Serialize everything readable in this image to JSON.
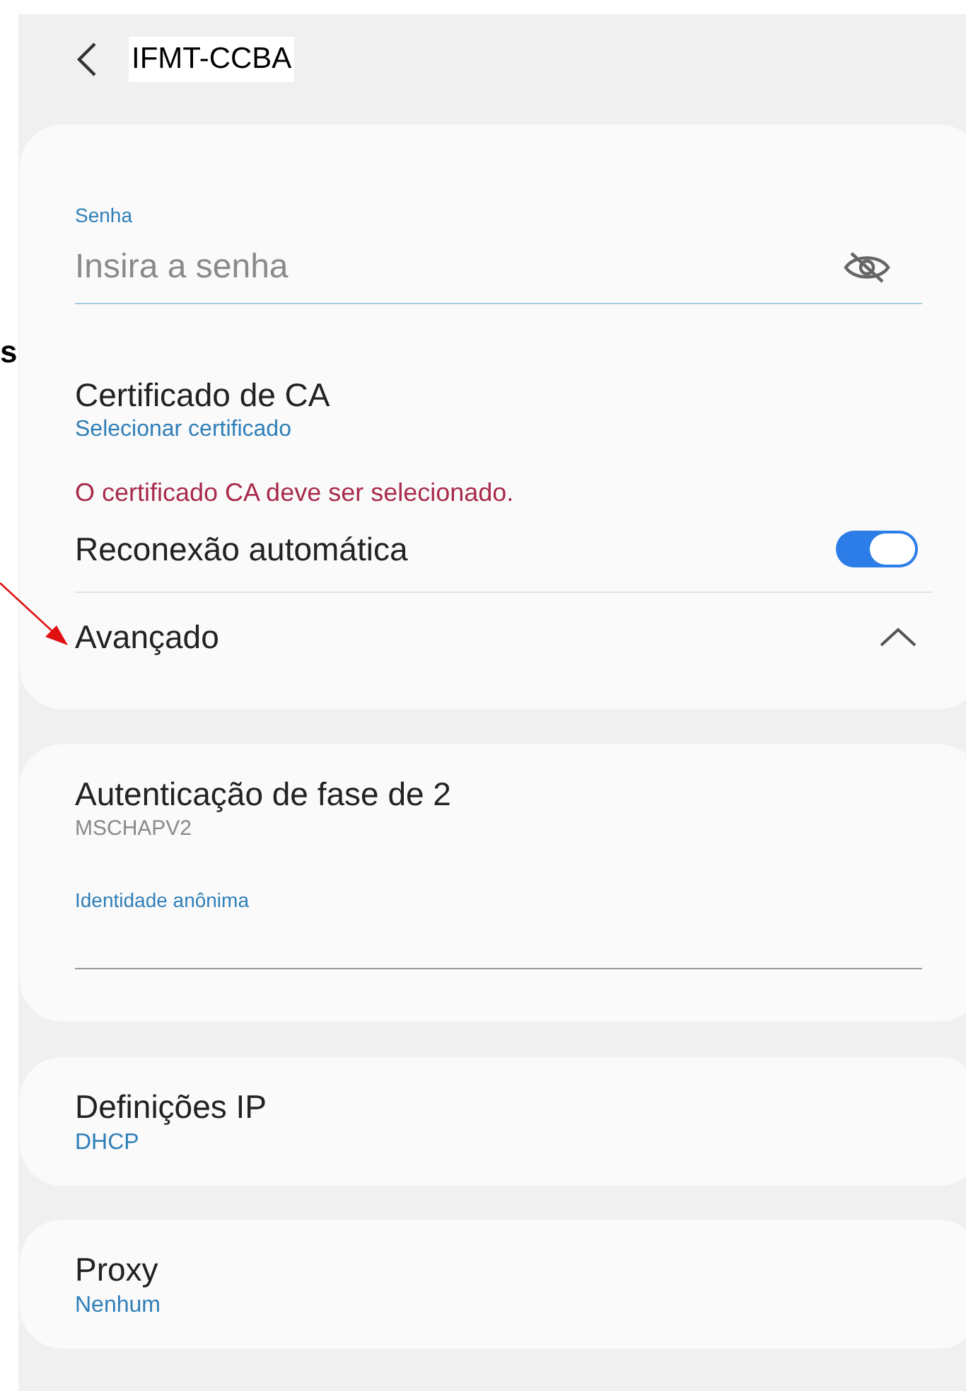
{
  "annotation": {
    "text": "s"
  },
  "header": {
    "title": "IFMT-CCBA"
  },
  "security_card": {
    "password": {
      "label": "Senha",
      "placeholder": "Insira a senha",
      "visible": false
    },
    "ca_certificate": {
      "title": "Certificado de CA",
      "value": "Selecionar certificado"
    },
    "error": "O certificado CA deve ser selecionado.",
    "auto_reconnect": {
      "label": "Reconexão automática",
      "on": true
    },
    "advanced": {
      "label": "Avançado",
      "expanded": true
    }
  },
  "phase2_card": {
    "title": "Autenticação de fase de 2",
    "value": "MSCHAPV2",
    "anonymous_identity": {
      "label": "Identidade anônima"
    }
  },
  "ip_card": {
    "title": "Definições IP",
    "value": "DHCP"
  },
  "proxy_card": {
    "title": "Proxy",
    "value": "Nenhum"
  }
}
